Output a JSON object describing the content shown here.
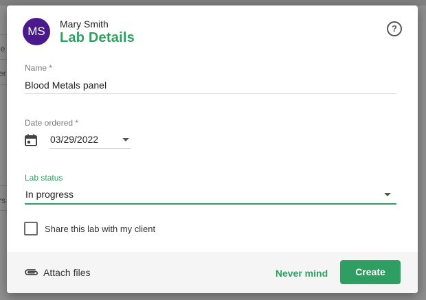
{
  "background": {
    "fragments": [
      "le",
      "er",
      "rs"
    ]
  },
  "dialog": {
    "avatar_initials": "MS",
    "client_name": "Mary Smith",
    "title": "Lab Details",
    "help_icon": "help-circle-icon",
    "name_field": {
      "label": "Name *",
      "value": "Blood Metals panel"
    },
    "date_field": {
      "label": "Date ordered *",
      "value": "03/29/2022",
      "icon": "calendar-icon"
    },
    "status_field": {
      "label": "Lab status",
      "value": "In progress"
    },
    "share_checkbox": {
      "label": "Share this lab with my client",
      "checked": false
    },
    "footer": {
      "attach_label": "Attach files",
      "attach_icon": "paperclip-icon",
      "cancel_label": "Never mind",
      "submit_label": "Create"
    }
  },
  "colors": {
    "accent": "#2e9e63",
    "avatar": "#4a1a8c",
    "footer_bg": "#f5f5f5"
  }
}
